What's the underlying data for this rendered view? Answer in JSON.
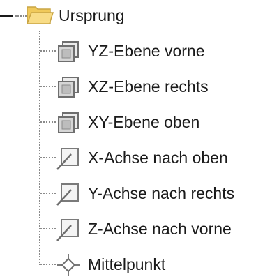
{
  "tree": {
    "root": {
      "label": "Ursprung",
      "icon": "folder-open-icon",
      "expanded": true
    },
    "items": [
      {
        "label": "YZ-Ebene vorne",
        "icon": "plane-icon"
      },
      {
        "label": "XZ-Ebene rechts",
        "icon": "plane-icon"
      },
      {
        "label": "XY-Ebene oben",
        "icon": "plane-icon"
      },
      {
        "label": "X-Achse nach oben",
        "icon": "axis-icon"
      },
      {
        "label": "Y-Achse nach rechts",
        "icon": "axis-icon"
      },
      {
        "label": "Z-Achse nach vorne",
        "icon": "axis-icon"
      },
      {
        "label": "Mittelpunkt",
        "icon": "point-icon"
      }
    ]
  },
  "colors": {
    "folder_fill": "#f5d77a",
    "folder_stroke": "#c9a545",
    "icon_stroke": "#6e6e6e",
    "icon_fill": "#d6d6d6",
    "connector": "#8a8a8a"
  }
}
